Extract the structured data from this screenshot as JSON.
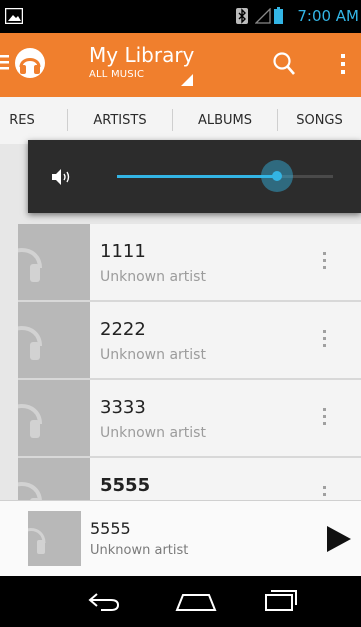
{
  "status_bar": {
    "time": "7:00 AM",
    "icons": [
      "picture-icon",
      "bluetooth-icon",
      "signal-icon",
      "battery-icon"
    ]
  },
  "action_bar": {
    "title": "My Library",
    "subtitle": "ALL MUSIC",
    "icons": [
      "menu-icon",
      "headphones-logo-icon",
      "dropdown-indicator-icon",
      "search-icon",
      "overflow-menu-icon"
    ]
  },
  "tabs": [
    {
      "label": "RES"
    },
    {
      "label": "ARTISTS"
    },
    {
      "label": "ALBUMS"
    },
    {
      "label": "SONGS"
    }
  ],
  "volume_dialog": {
    "icon": "speaker-icon",
    "level": 0.74
  },
  "songs": [
    {
      "title": "1111",
      "artist": "Unknown artist"
    },
    {
      "title": "2222",
      "artist": "Unknown artist"
    },
    {
      "title": "3333",
      "artist": "Unknown artist"
    },
    {
      "title": "5555",
      "artist": ""
    }
  ],
  "now_playing": {
    "title": "5555",
    "artist": "Unknown artist",
    "control_icon": "play-icon"
  },
  "nav_bar": {
    "icons": [
      "back-icon",
      "home-icon",
      "recent-apps-icon"
    ]
  },
  "colors": {
    "accent": "#f07f2d",
    "holo_blue": "#33b5e5",
    "status_bar": "#000000",
    "list_background": "#f4f4f4"
  }
}
